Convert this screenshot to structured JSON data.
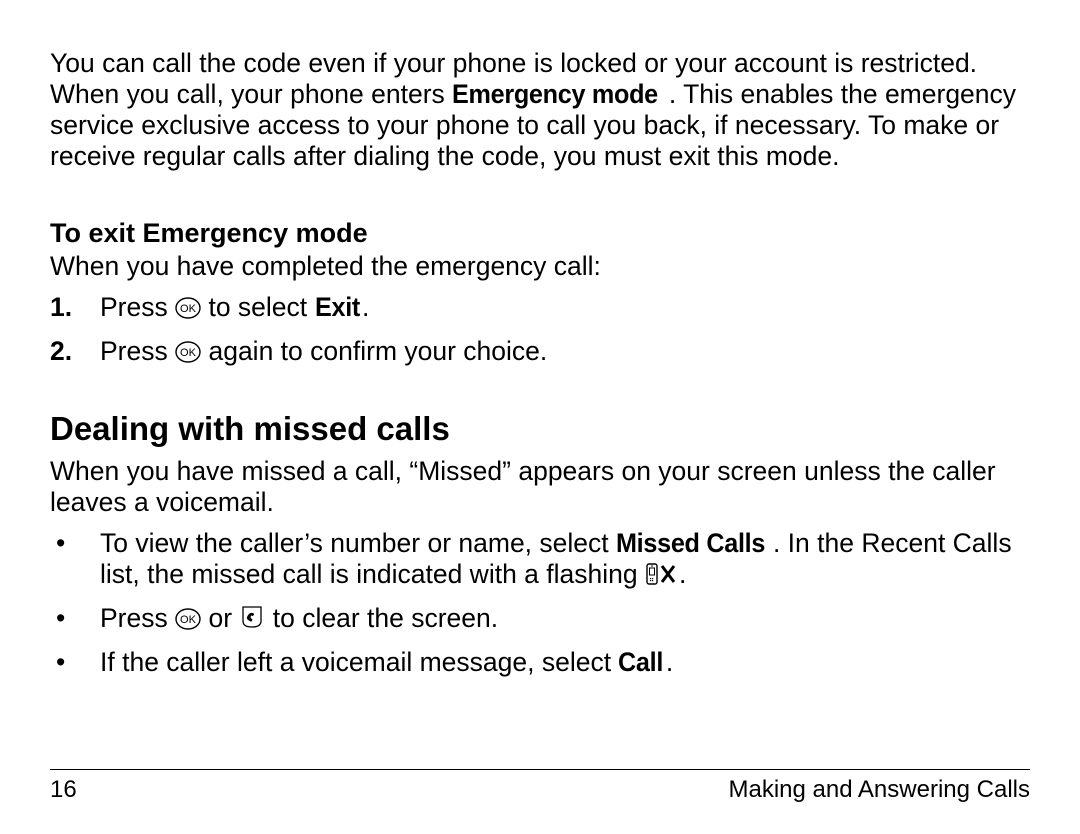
{
  "intro": {
    "pre1": "You can call the code even if your phone is locked or your account is restricted. When you call, your phone enters ",
    "em_mode": "Emergency mode",
    "post1": ". This enables the emergency service exclusive access to your phone to call you back, if necessary. To make or receive regular calls after dialing the code, you must exit this mode."
  },
  "exit_header": "To exit Emergency mode",
  "exit_lead": "When you have completed the emergency call:",
  "exit_steps": {
    "m1": "1.",
    "s1a": "Press ",
    "s1b": " to select ",
    "s1_exit": "Exit",
    "s1c": ".",
    "m2": "2.",
    "s2a": "Press ",
    "s2b": " again to confirm your choice."
  },
  "missed_header": "Dealing with missed calls",
  "missed_intro": "When you have missed a call, “Missed” appears on your screen unless the caller leaves a voicemail.",
  "bullets": {
    "b1a": "To view the caller’s number or name, select ",
    "b1_missed": "Missed Calls",
    "b1b": ". In the Recent Calls list, the missed call is indicated with a flashing ",
    "b1c": ".",
    "b2a": "Press ",
    "b2b": " or ",
    "b2c": " to clear the screen.",
    "b3a": "If the caller left a voicemail message, select ",
    "b3_call": "Call",
    "b3b": "."
  },
  "footer": {
    "page": "16",
    "section": "Making and Answering Calls"
  }
}
